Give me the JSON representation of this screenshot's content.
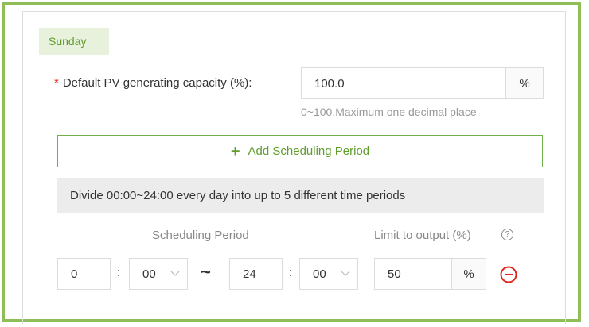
{
  "day_tab": "Sunday",
  "capacity": {
    "required_mark": "*",
    "label": "Default PV generating capacity (%):",
    "value": "100.0",
    "unit": "%",
    "hint": "0~100,Maximum one decimal place"
  },
  "add_button": {
    "icon": "plus-icon",
    "label": "Add Scheduling Period"
  },
  "info_text": "Divide 00:00~24:00 every day into up to 5 different time periods",
  "columns": {
    "period": "Scheduling Period",
    "limit": "Limit to output (%)"
  },
  "period_row": {
    "start_hour": "0",
    "start_minute": "00",
    "separator": ":",
    "range_sep": "~",
    "end_hour": "24",
    "end_minute": "00",
    "limit_value": "50",
    "limit_unit": "%"
  },
  "colors": {
    "accent": "#5f9d2c",
    "frame": "#8fbd57",
    "danger": "#e0261c"
  }
}
